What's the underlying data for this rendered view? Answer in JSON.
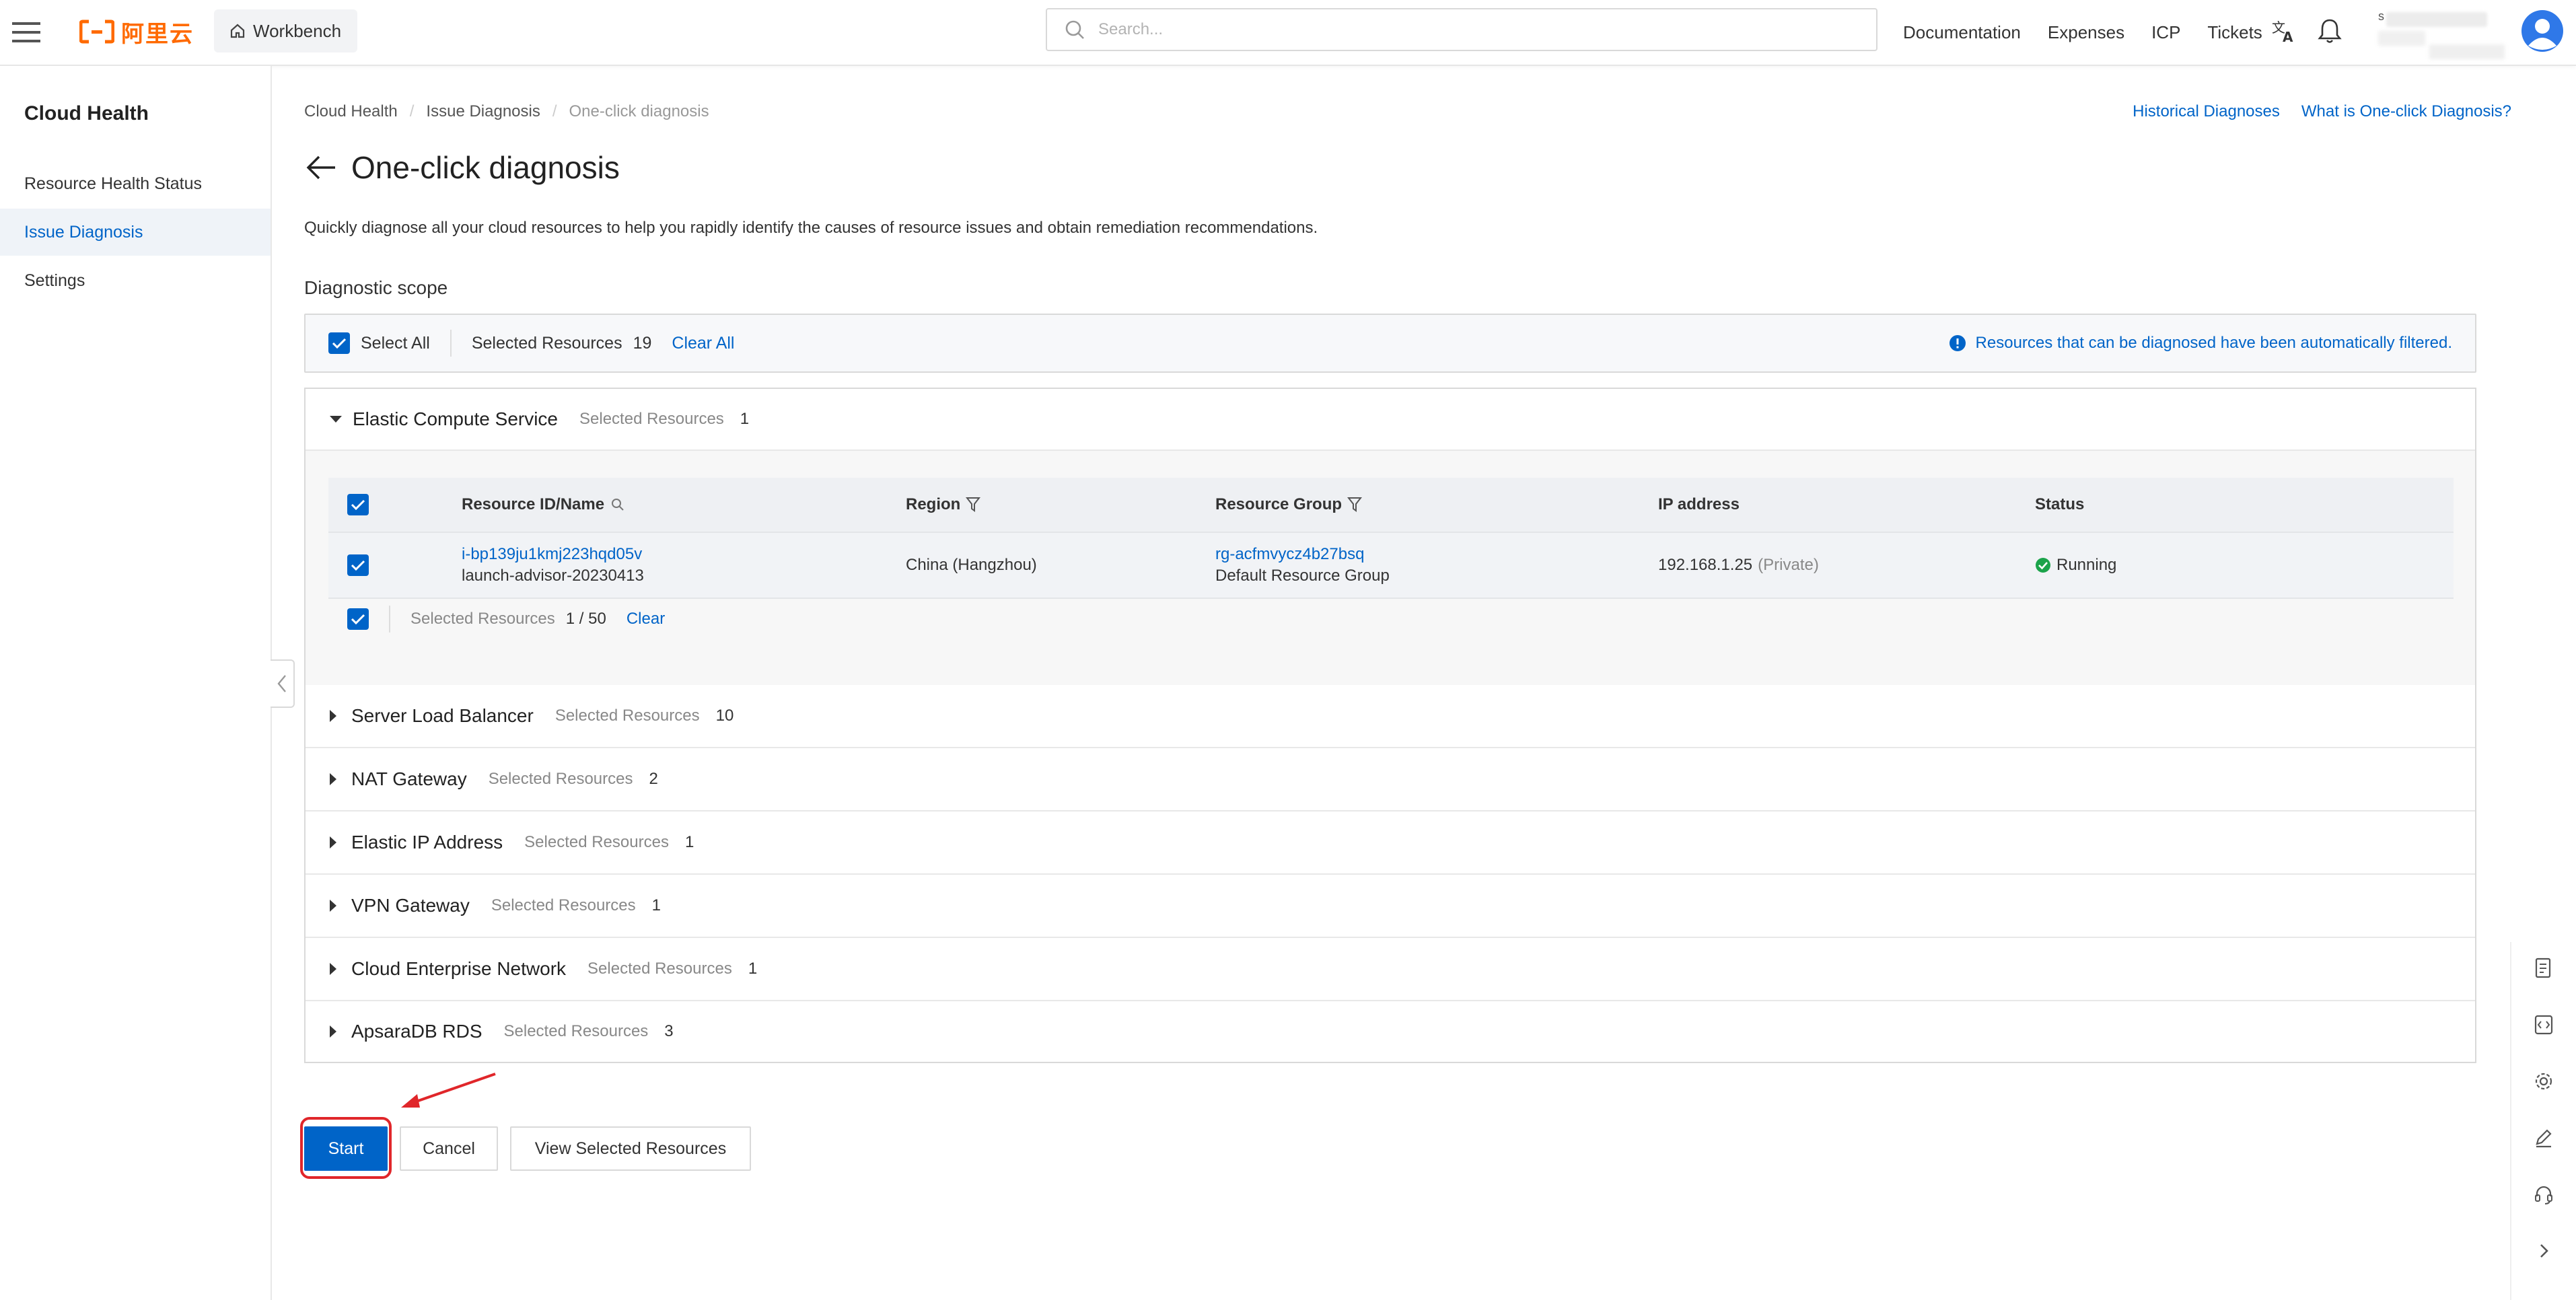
{
  "topbar": {
    "logo_text": "阿里云",
    "workbench_label": "Workbench",
    "search_placeholder": "Search...",
    "links": [
      "Documentation",
      "Expenses",
      "ICP",
      "Tickets"
    ],
    "user_initial": "s"
  },
  "sidebar": {
    "title": "Cloud Health",
    "items": [
      {
        "label": "Resource Health Status",
        "active": false
      },
      {
        "label": "Issue Diagnosis",
        "active": true
      },
      {
        "label": "Settings",
        "active": false
      }
    ]
  },
  "breadcrumb": [
    "Cloud Health",
    "Issue Diagnosis",
    "One-click diagnosis"
  ],
  "header_links": {
    "historical": "Historical Diagnoses",
    "what_is": "What is One-click Diagnosis?"
  },
  "page": {
    "title": "One-click diagnosis",
    "description": "Quickly diagnose all your cloud resources to help you rapidly identify the causes of resource issues and obtain remediation recommendations.",
    "scope_title": "Diagnostic scope"
  },
  "select_bar": {
    "select_all": "Select All",
    "selected_label": "Selected Resources",
    "selected_count": "19",
    "clear_all": "Clear All",
    "info": "Resources that can be diagnosed have been automatically filtered."
  },
  "groups": [
    {
      "name": "Elastic Compute Service",
      "selected_label": "Selected Resources",
      "count": "1",
      "expanded": true
    },
    {
      "name": "Server Load Balancer",
      "selected_label": "Selected Resources",
      "count": "10"
    },
    {
      "name": "NAT Gateway",
      "selected_label": "Selected Resources",
      "count": "2"
    },
    {
      "name": "Elastic IP Address",
      "selected_label": "Selected Resources",
      "count": "1"
    },
    {
      "name": "VPN Gateway",
      "selected_label": "Selected Resources",
      "count": "1"
    },
    {
      "name": "Cloud Enterprise Network",
      "selected_label": "Selected Resources",
      "count": "1"
    },
    {
      "name": "ApsaraDB RDS",
      "selected_label": "Selected Resources",
      "count": "3"
    }
  ],
  "ecs_table": {
    "columns": [
      "Resource ID/Name",
      "Region",
      "Resource Group",
      "IP address",
      "Status"
    ],
    "rows": [
      {
        "id": "i-bp139ju1kmj223hqd05v",
        "name": "launch-advisor-20230413",
        "region": "China (Hangzhou)",
        "group_id": "rg-acfmvycz4b27bsq",
        "group_name": "Default Resource Group",
        "ip": "192.168.1.25",
        "ip_type": "(Private)",
        "status": "Running"
      }
    ],
    "footer_label": "Selected Resources",
    "footer_count": "1 / 50",
    "footer_clear": "Clear"
  },
  "buttons": {
    "start": "Start",
    "cancel": "Cancel",
    "view": "View Selected Resources"
  },
  "colors": {
    "primary": "#0064c8",
    "brand": "#ff6a00",
    "success": "#1ba34a",
    "highlight": "#e0262a"
  }
}
